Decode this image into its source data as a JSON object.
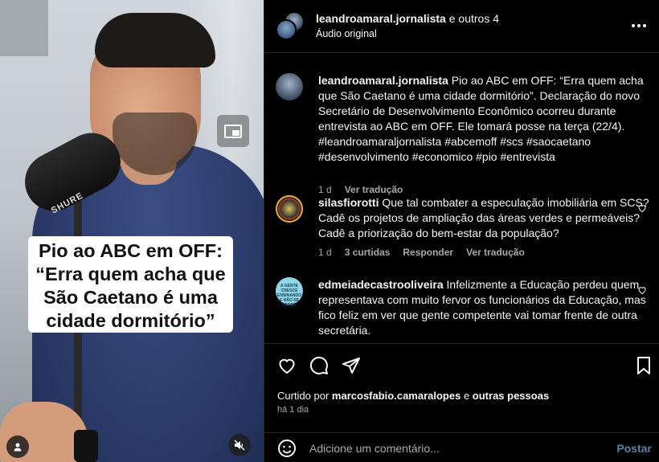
{
  "video": {
    "caption_lines": [
      "Pio ao ABC em OFF:",
      "“Erra quem acha que",
      "São Caetano é uma",
      "cidade dormitório”"
    ],
    "mic_brand": "SHURE",
    "icons": {
      "pip": "picture-in-picture-icon",
      "user": "user-icon",
      "mute": "muted-speaker-icon"
    }
  },
  "header": {
    "author": "leandroamaral.jornalista",
    "collab_suffix": " e outros 4",
    "audio": "Áudio original"
  },
  "caption": {
    "username": "leandroamaral.jornalista",
    "text": "Pio ao ABC em OFF: “Erra quem acha que São Caetano é uma cidade dormitório”. Declaração do novo Secretário de Desenvolvimento Econômico ocorreu durante entrevista ao ABC em OFF. Ele tomará posse na terça (22/4). #leandroamaraljornalista #abcemoff #scs #saocaetano #desenvolvimento #economico #pio #entrevista",
    "time": "1 d",
    "translate": "Ver tradução"
  },
  "comments": [
    {
      "username": "silasfiorotti",
      "text": "Que tal combater a especulação imobiliária em SCS? Cadê os projetos de ampliação das áreas verdes e permeáveis? Cadê a priorização do bem-estar da população?",
      "time": "1 d",
      "likes": "3 curtidas",
      "reply": "Responder",
      "translate": "Ver tradução"
    },
    {
      "username": "edmeiadecastrooliveira",
      "text": "Infelizmente a Educação perdeu quem representava com muito fervor os funcionários da Educação, mas fico feliz em ver que gente competente vai tomar frente de outra secretária.",
      "avatar_text": "A GENTE CRESCE ENSINANDO E NÃO SE PERDE"
    }
  ],
  "footer": {
    "liked_prefix": "Curtido por ",
    "liked_user": "marcosfabio.camaralopes",
    "liked_mid": " e ",
    "liked_others": "outras pessoas",
    "when": "há 1 dia",
    "add_comment_placeholder": "Adicione um comentário...",
    "post_label": "Postar"
  },
  "colors": {
    "background": "#000000",
    "muted_text": "#a8a8a8",
    "post_link": "#5f7fa3",
    "divider": "#262626"
  }
}
